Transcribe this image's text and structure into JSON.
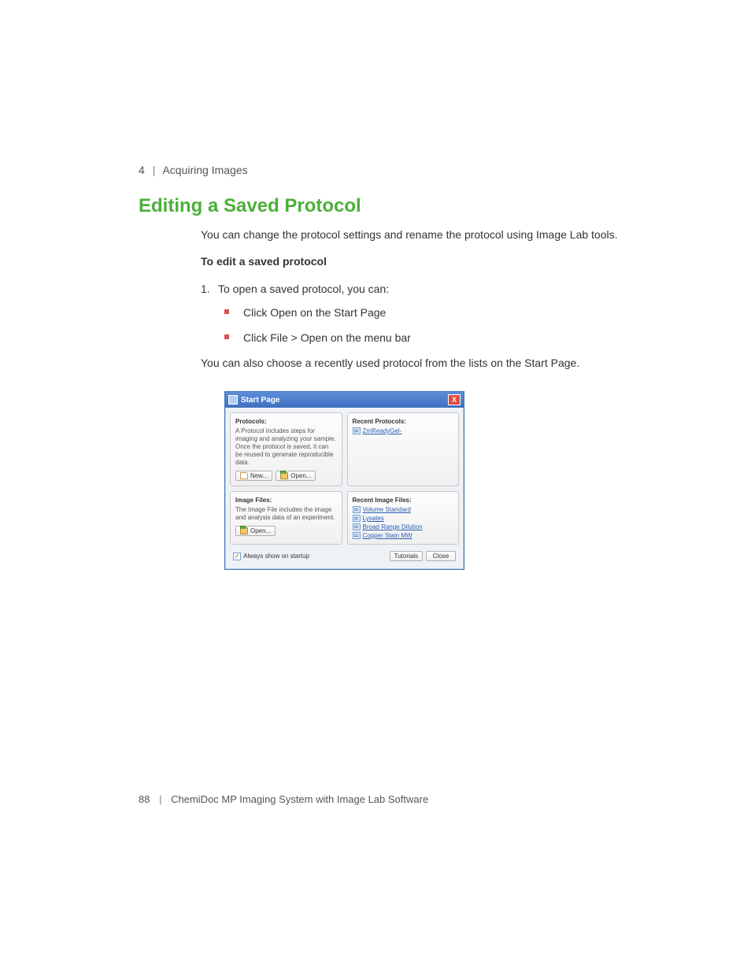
{
  "header": {
    "chapter_num": "4",
    "chapter_title": "Acquiring Images"
  },
  "heading": "Editing a Saved Protocol",
  "intro": "You can change the protocol settings and rename the protocol using Image Lab tools.",
  "subhead": "To edit a saved protocol",
  "step1": {
    "num": "1.",
    "text": "To open a saved protocol, you can:"
  },
  "bullets": {
    "b1": "Click Open on the Start Page",
    "b2": "Click File > Open on the menu bar"
  },
  "after": "You can also choose a recently used protocol from the lists on the Start Page.",
  "footer": {
    "page": "88",
    "book": "ChemiDoc MP Imaging System with Image Lab Software"
  },
  "dialog": {
    "title": "Start Page",
    "close": "X",
    "protocols": {
      "title": "Protocols:",
      "desc": "A Protocol includes steps for imaging and analyzing your sample. Once the protocol is saved, it can be reused to generate reproducible data.",
      "new": "New...",
      "open": "Open..."
    },
    "recent_protocols": {
      "title": "Recent Protocols:",
      "item1": "ZmReadyGel-"
    },
    "image_files": {
      "title": "Image Files:",
      "desc": "The Image File includes the image and analysis data of an experiment.",
      "open": "Open..."
    },
    "recent_images": {
      "title": "Recent Image Files:",
      "item1": "Volume Standard",
      "item2": "Lysates",
      "item3": "Broad Range Dilution",
      "item4": "Copper Stain MW"
    },
    "always": "Always show on startup",
    "tutorials": "Tutorials",
    "closebtn": "Close"
  }
}
